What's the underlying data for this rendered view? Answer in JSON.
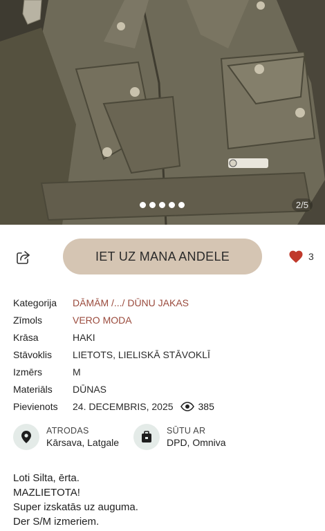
{
  "gallery": {
    "counter": "2/5",
    "dots": 5,
    "active_dot": 0,
    "patch_text": "CRYSTAL LODGE"
  },
  "actions": {
    "cta_label": "IET UZ MANA ANDELE",
    "likes": "3"
  },
  "details": [
    {
      "label": "Kategorija",
      "value": "DĀMĀM /.../ DŪNU JAKAS"
    },
    {
      "label": "Zīmols",
      "value": "VERO MODA"
    },
    {
      "label": "Krāsa",
      "value": "HAKI"
    },
    {
      "label": "Stāvoklis",
      "value": "LIETOTS, LIELISKĀ STĀVOKLĪ"
    },
    {
      "label": "Izmērs",
      "value": "M"
    },
    {
      "label": "Materiāls",
      "value": "DŪNAS"
    },
    {
      "label": "Pievienots",
      "value": "24. DECEMBRIS, 2025"
    }
  ],
  "views": "385",
  "location": {
    "label": "ATRODAS",
    "value": "Kārsava, Latgale"
  },
  "shipping": {
    "label": "SŪTU AR",
    "value": "DPD, Omniva"
  },
  "description": [
    "Loti Silta, ērta.",
    "MAZLIETOTA!",
    "Super izskatās uz auguma.",
    "Der S/M izmeriem."
  ],
  "colors": {
    "accent_link": "#9a4a3c",
    "cta_bg": "#d5c5b3",
    "heart": "#c0392b",
    "icon_circle": "#e4ebe8"
  }
}
